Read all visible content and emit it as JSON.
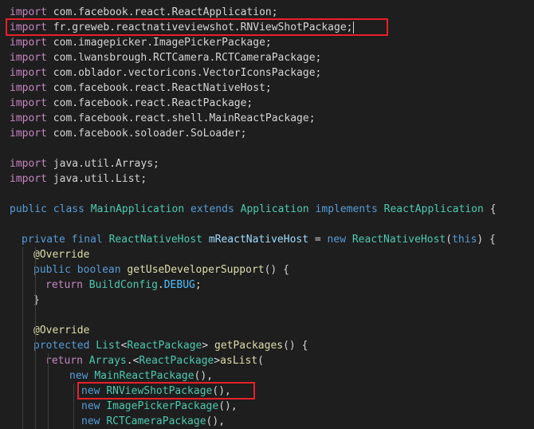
{
  "colors": {
    "background": "#1e1e1e",
    "highlight_box": "#e8202a",
    "keyword": "#569cd6",
    "control": "#c586c0",
    "type": "#4ec9b0",
    "function": "#dcdcaa",
    "variable": "#9cdcfe",
    "constant": "#4fc1ff",
    "text": "#d4d4d4",
    "annotation": "#dcdcaa"
  },
  "editor": {
    "lines": [
      {
        "indent": 0,
        "tokens": [
          {
            "t": "import",
            "c": "control"
          },
          {
            "t": " com.facebook.react.ReactApplication;",
            "c": "text"
          }
        ]
      },
      {
        "indent": 0,
        "caret": true,
        "tokens": [
          {
            "t": "import",
            "c": "control"
          },
          {
            "t": " fr.greweb.reactnativeviewshot.RNViewShotPackage;",
            "c": "text"
          }
        ]
      },
      {
        "indent": 0,
        "tokens": [
          {
            "t": "import",
            "c": "control"
          },
          {
            "t": " com.imagepicker.ImagePickerPackage;",
            "c": "text"
          }
        ]
      },
      {
        "indent": 0,
        "tokens": [
          {
            "t": "import",
            "c": "control"
          },
          {
            "t": " com.lwansbrough.RCTCamera.RCTCameraPackage;",
            "c": "text"
          }
        ]
      },
      {
        "indent": 0,
        "tokens": [
          {
            "t": "import",
            "c": "control"
          },
          {
            "t": " com.oblador.vectoricons.VectorIconsPackage;",
            "c": "text"
          }
        ]
      },
      {
        "indent": 0,
        "tokens": [
          {
            "t": "import",
            "c": "control"
          },
          {
            "t": " com.facebook.react.ReactNativeHost;",
            "c": "text"
          }
        ]
      },
      {
        "indent": 0,
        "tokens": [
          {
            "t": "import",
            "c": "control"
          },
          {
            "t": " com.facebook.react.ReactPackage;",
            "c": "text"
          }
        ]
      },
      {
        "indent": 0,
        "tokens": [
          {
            "t": "import",
            "c": "control"
          },
          {
            "t": " com.facebook.react.shell.MainReactPackage;",
            "c": "text"
          }
        ]
      },
      {
        "indent": 0,
        "tokens": [
          {
            "t": "import",
            "c": "control"
          },
          {
            "t": " com.facebook.soloader.SoLoader;",
            "c": "text"
          }
        ]
      },
      {
        "indent": 0,
        "tokens": []
      },
      {
        "indent": 0,
        "tokens": [
          {
            "t": "import",
            "c": "control"
          },
          {
            "t": " java.util.Arrays;",
            "c": "text"
          }
        ]
      },
      {
        "indent": 0,
        "tokens": [
          {
            "t": "import",
            "c": "control"
          },
          {
            "t": " java.util.List;",
            "c": "text"
          }
        ]
      },
      {
        "indent": 0,
        "tokens": []
      },
      {
        "indent": 0,
        "tokens": [
          {
            "t": "public",
            "c": "keyword"
          },
          {
            "t": " ",
            "c": "text"
          },
          {
            "t": "class",
            "c": "keyword"
          },
          {
            "t": " ",
            "c": "text"
          },
          {
            "t": "MainApplication",
            "c": "type"
          },
          {
            "t": " ",
            "c": "text"
          },
          {
            "t": "extends",
            "c": "keyword"
          },
          {
            "t": " ",
            "c": "text"
          },
          {
            "t": "Application",
            "c": "type"
          },
          {
            "t": " ",
            "c": "text"
          },
          {
            "t": "implements",
            "c": "keyword"
          },
          {
            "t": " ",
            "c": "text"
          },
          {
            "t": "ReactApplication",
            "c": "type"
          },
          {
            "t": " {",
            "c": "text"
          }
        ]
      },
      {
        "indent": 0,
        "tokens": []
      },
      {
        "indent": 1,
        "tokens": [
          {
            "t": "private",
            "c": "keyword"
          },
          {
            "t": " ",
            "c": "text"
          },
          {
            "t": "final",
            "c": "keyword"
          },
          {
            "t": " ",
            "c": "text"
          },
          {
            "t": "ReactNativeHost",
            "c": "type"
          },
          {
            "t": " ",
            "c": "text"
          },
          {
            "t": "mReactNativeHost",
            "c": "variable"
          },
          {
            "t": " = ",
            "c": "text"
          },
          {
            "t": "new",
            "c": "keyword"
          },
          {
            "t": " ",
            "c": "text"
          },
          {
            "t": "ReactNativeHost",
            "c": "type"
          },
          {
            "t": "(",
            "c": "text"
          },
          {
            "t": "this",
            "c": "keyword"
          },
          {
            "t": ") {",
            "c": "text"
          }
        ]
      },
      {
        "indent": 2,
        "tokens": [
          {
            "t": "@Override",
            "c": "annotation"
          }
        ]
      },
      {
        "indent": 2,
        "tokens": [
          {
            "t": "public",
            "c": "keyword"
          },
          {
            "t": " ",
            "c": "text"
          },
          {
            "t": "boolean",
            "c": "keyword"
          },
          {
            "t": " ",
            "c": "text"
          },
          {
            "t": "getUseDeveloperSupport",
            "c": "function"
          },
          {
            "t": "() {",
            "c": "text"
          }
        ]
      },
      {
        "indent": 3,
        "tokens": [
          {
            "t": "return",
            "c": "control"
          },
          {
            "t": " ",
            "c": "text"
          },
          {
            "t": "BuildConfig",
            "c": "type"
          },
          {
            "t": ".",
            "c": "text"
          },
          {
            "t": "DEBUG",
            "c": "constant"
          },
          {
            "t": ";",
            "c": "text"
          }
        ]
      },
      {
        "indent": 2,
        "tokens": [
          {
            "t": "}",
            "c": "text"
          }
        ]
      },
      {
        "indent": 0,
        "tokens": []
      },
      {
        "indent": 2,
        "tokens": [
          {
            "t": "@Override",
            "c": "annotation"
          }
        ]
      },
      {
        "indent": 2,
        "tokens": [
          {
            "t": "protected",
            "c": "keyword"
          },
          {
            "t": " ",
            "c": "text"
          },
          {
            "t": "List",
            "c": "type"
          },
          {
            "t": "<",
            "c": "text"
          },
          {
            "t": "ReactPackage",
            "c": "type"
          },
          {
            "t": "> ",
            "c": "text"
          },
          {
            "t": "getPackages",
            "c": "function"
          },
          {
            "t": "() {",
            "c": "text"
          }
        ]
      },
      {
        "indent": 3,
        "tokens": [
          {
            "t": "return",
            "c": "control"
          },
          {
            "t": " ",
            "c": "text"
          },
          {
            "t": "Arrays",
            "c": "type"
          },
          {
            "t": ".<",
            "c": "text"
          },
          {
            "t": "ReactPackage",
            "c": "type"
          },
          {
            "t": ">",
            "c": "text"
          },
          {
            "t": "asList",
            "c": "function"
          },
          {
            "t": "(",
            "c": "text"
          }
        ]
      },
      {
        "indent": 5,
        "tokens": [
          {
            "t": "new",
            "c": "keyword"
          },
          {
            "t": " ",
            "c": "text"
          },
          {
            "t": "MainReactPackage",
            "c": "type"
          },
          {
            "t": "(),",
            "c": "text"
          }
        ]
      },
      {
        "indent": 6,
        "tokens": [
          {
            "t": "new",
            "c": "keyword"
          },
          {
            "t": " ",
            "c": "text"
          },
          {
            "t": "RNViewShotPackage",
            "c": "type"
          },
          {
            "t": "(),",
            "c": "text"
          }
        ]
      },
      {
        "indent": 6,
        "tokens": [
          {
            "t": "new",
            "c": "keyword"
          },
          {
            "t": " ",
            "c": "text"
          },
          {
            "t": "ImagePickerPackage",
            "c": "type"
          },
          {
            "t": "(),",
            "c": "text"
          }
        ]
      },
      {
        "indent": 6,
        "tokens": [
          {
            "t": "new",
            "c": "keyword"
          },
          {
            "t": " ",
            "c": "text"
          },
          {
            "t": "RCTCameraPackage",
            "c": "type"
          },
          {
            "t": "(),",
            "c": "text"
          }
        ]
      }
    ]
  },
  "highlights": [
    {
      "line": 1,
      "name": "highlight-import-rnviewshot"
    },
    {
      "line": 25,
      "name": "highlight-new-rnviewshot"
    }
  ]
}
